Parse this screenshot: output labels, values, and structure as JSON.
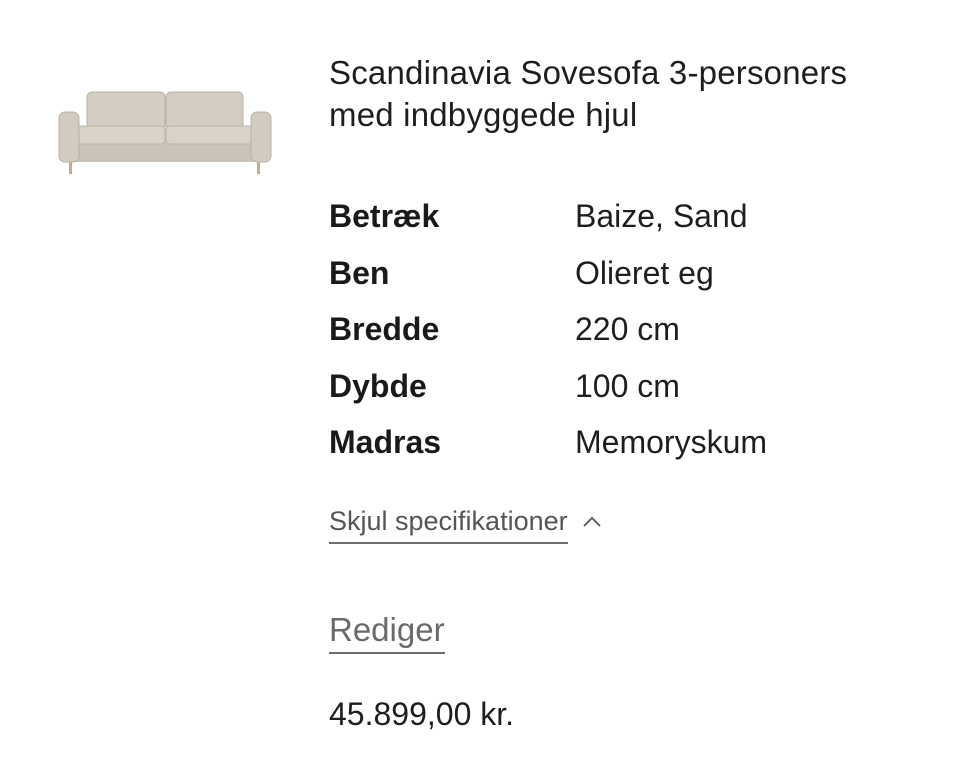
{
  "product": {
    "image_icon": "sofa-image",
    "title": "Scandinavia Sovesofa 3-personers med indbyggede hjul",
    "specs": [
      {
        "label": "Betræk",
        "value": "Baize, Sand"
      },
      {
        "label": "Ben",
        "value": "Olieret eg"
      },
      {
        "label": "Bredde",
        "value": "220 cm"
      },
      {
        "label": "Dybde",
        "value": "100 cm"
      },
      {
        "label": "Madras",
        "value": "Memoryskum"
      }
    ],
    "toggle_specs_label": "Skjul specifikationer",
    "toggle_icon": "chevron-up-icon",
    "edit_label": "Rediger",
    "price": "45.899,00 kr."
  },
  "colors": {
    "text": "#1e1e1e",
    "link": "#555555",
    "background": "#ffffff",
    "sofa_fabric": "#cfc9bf",
    "sofa_legs": "#c8ab86"
  }
}
